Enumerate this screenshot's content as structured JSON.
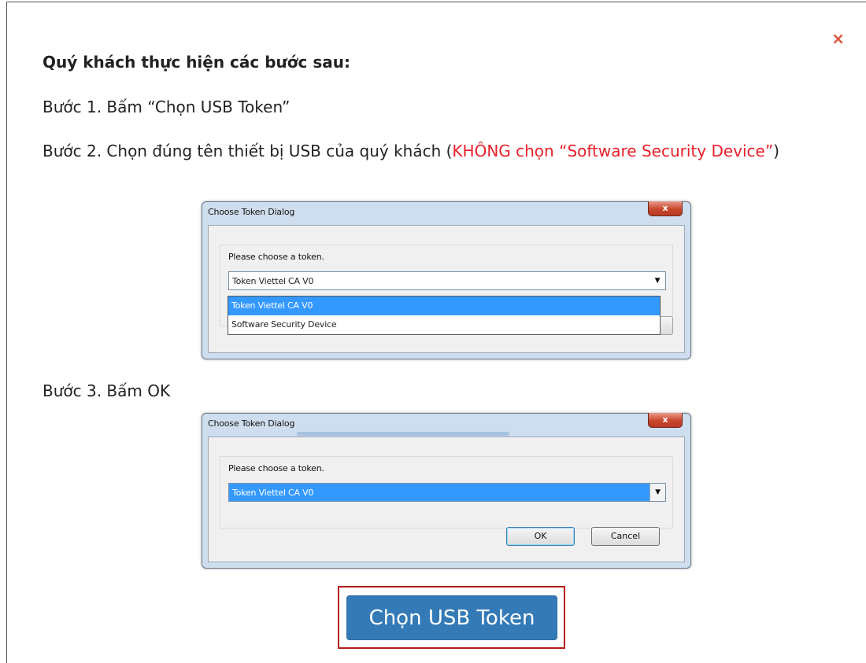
{
  "modal": {
    "close_label": "×",
    "title": "Quý khách thực hiện các bước sau:",
    "step1": "Bước 1. Bấm “Chọn USB Token”",
    "step2_text": "Bước 2. Chọn đúng tên thiết bị USB của quý khách (",
    "step2_warning": "KHÔNG chọn “Software Security Device”",
    "step2_end": ")",
    "step3": "Bước 3. Bấm OK",
    "button_label": "Chọn USB Token"
  },
  "dialog1": {
    "title": "Choose Token Dialog",
    "close_label": "x",
    "prompt": "Please choose a token.",
    "selected": "Token Viettel CA V0",
    "options": [
      "Token Viettel CA V0",
      "Software Security Device"
    ]
  },
  "dialog2": {
    "title": "Choose Token Dialog",
    "close_label": "x",
    "prompt": "Please choose a token.",
    "selected": "Token Viettel CA V0",
    "ok_label": "OK",
    "cancel_label": "Cancel"
  },
  "colors": {
    "warning": "#e8202a",
    "primary_button": "#337ab7",
    "highlight_frame": "#b31b1b",
    "close_x": "#d9533a"
  }
}
